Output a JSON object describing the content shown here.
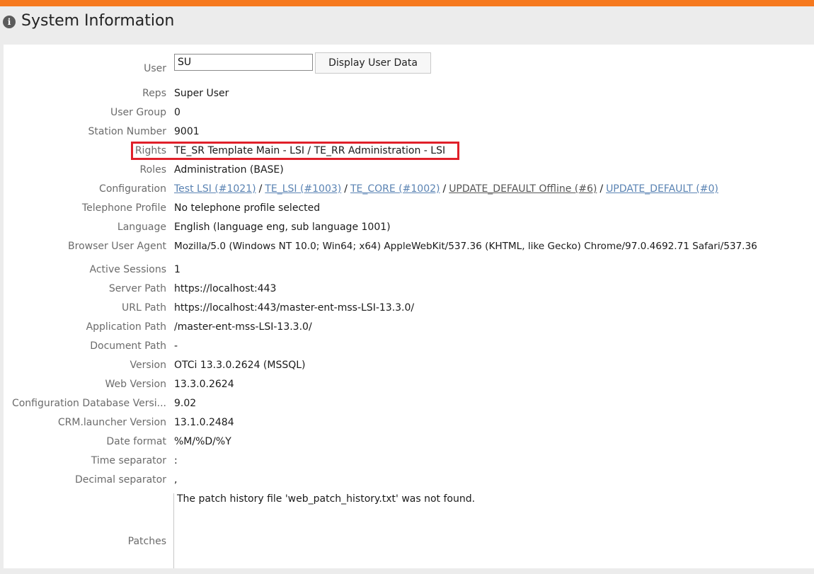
{
  "header": {
    "title": "System Information",
    "icon": "info-icon"
  },
  "user": {
    "label": "User",
    "value": "SU",
    "button": "Display User Data"
  },
  "fields": {
    "reps": {
      "label": "Reps",
      "value": "Super User"
    },
    "user_group": {
      "label": "User Group",
      "value": "0"
    },
    "station_number": {
      "label": "Station Number",
      "value": "9001"
    },
    "rights": {
      "label": "Rights",
      "value": "TE_SR Template Main - LSI / TE_RR Administration - LSI"
    },
    "roles": {
      "label": "Roles",
      "value": "Administration (BASE)"
    },
    "configuration": {
      "label": "Configuration",
      "links": [
        "Test LSI (#1021)",
        "TE_LSI (#1003)",
        "TE_CORE (#1002)",
        "UPDATE_DEFAULT Offline (#6)",
        "UPDATE_DEFAULT (#0)"
      ],
      "separator": "/"
    },
    "telephone_profile": {
      "label": "Telephone Profile",
      "value": "No telephone profile selected"
    },
    "language": {
      "label": "Language",
      "value": "English (language eng, sub language 1001)"
    },
    "browser_user_agent": {
      "label": "Browser User Agent",
      "value": "Mozilla/5.0 (Windows NT 10.0; Win64; x64) AppleWebKit/537.36 (KHTML, like Gecko) Chrome/97.0.4692.71 Safari/537.36"
    },
    "active_sessions": {
      "label": "Active Sessions",
      "value": "1"
    },
    "server_path": {
      "label": "Server Path",
      "value": "https://localhost:443"
    },
    "url_path": {
      "label": "URL Path",
      "value": "https://localhost:443/master-ent-mss-LSI-13.3.0/"
    },
    "application_path": {
      "label": "Application Path",
      "value": "/master-ent-mss-LSI-13.3.0/"
    },
    "document_path": {
      "label": "Document Path",
      "value": "-"
    },
    "version": {
      "label": "Version",
      "value": "OTCi 13.3.0.2624 (MSSQL)"
    },
    "web_version": {
      "label": "Web Version",
      "value": "13.3.0.2624"
    },
    "config_db_version": {
      "label": "Configuration Database Versi...",
      "value": "9.02"
    },
    "crm_launcher_version": {
      "label": "CRM.launcher Version",
      "value": "13.1.0.2484"
    },
    "date_format": {
      "label": "Date format",
      "value": "%M/%D/%Y"
    },
    "time_separator": {
      "label": "Time separator",
      "value": ":"
    },
    "decimal_separator": {
      "label": "Decimal separator",
      "value": ","
    },
    "patches": {
      "label": "Patches",
      "value": "The patch history file 'web_patch_history.txt' was not found."
    }
  },
  "colors": {
    "accent": "#f6791e",
    "highlight": "#e0202a",
    "link": "#5a83b3"
  }
}
